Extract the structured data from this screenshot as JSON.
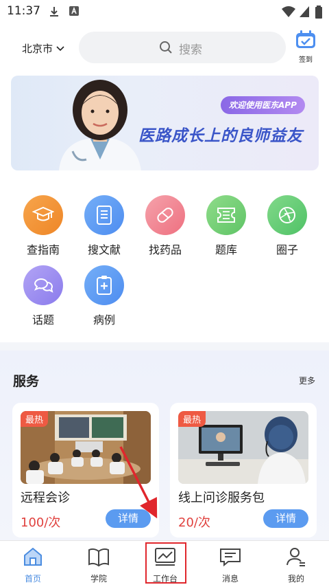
{
  "status_bar": {
    "time": "11:37"
  },
  "header": {
    "city": "北京市",
    "search_placeholder": "搜索",
    "signin_label": "签到"
  },
  "banner": {
    "badge": "欢迎使用医东APP",
    "title": "医路成长上的良师益友"
  },
  "features": [
    {
      "label": "查指南",
      "icon": "graduation-cap-icon",
      "color": "#f29637"
    },
    {
      "label": "搜文献",
      "icon": "document-icon",
      "color": "#5d9cf2"
    },
    {
      "label": "找药品",
      "icon": "pill-icon",
      "color": "#f07b8a"
    },
    {
      "label": "题库",
      "icon": "ticket-icon",
      "color": "#6fce72"
    },
    {
      "label": "圈子",
      "icon": "aperture-icon",
      "color": "#5ccc6c"
    },
    {
      "label": "话题",
      "icon": "chat-bubbles-icon",
      "color": "#9c8df0"
    },
    {
      "label": "病例",
      "icon": "medical-record-icon",
      "color": "#5d9cf2"
    }
  ],
  "services": {
    "title": "服务",
    "more": "更多",
    "cards": [
      {
        "badge": "最热",
        "name": "远程会诊",
        "price": "100/次",
        "button": "详情"
      },
      {
        "badge": "最热",
        "name": "线上问诊服务包",
        "price": "20/次",
        "button": "详情"
      }
    ]
  },
  "nav": [
    {
      "label": "首页",
      "icon": "home-icon",
      "active": true
    },
    {
      "label": "学院",
      "icon": "book-icon"
    },
    {
      "label": "工作台",
      "icon": "workbench-chart-icon"
    },
    {
      "label": "消息",
      "icon": "message-icon"
    },
    {
      "label": "我的",
      "icon": "profile-icon"
    }
  ],
  "colors": {
    "accent": "#4a8ce0",
    "price": "#e0423f",
    "hot": "#ee5a43",
    "annotation": "#e0262c"
  }
}
